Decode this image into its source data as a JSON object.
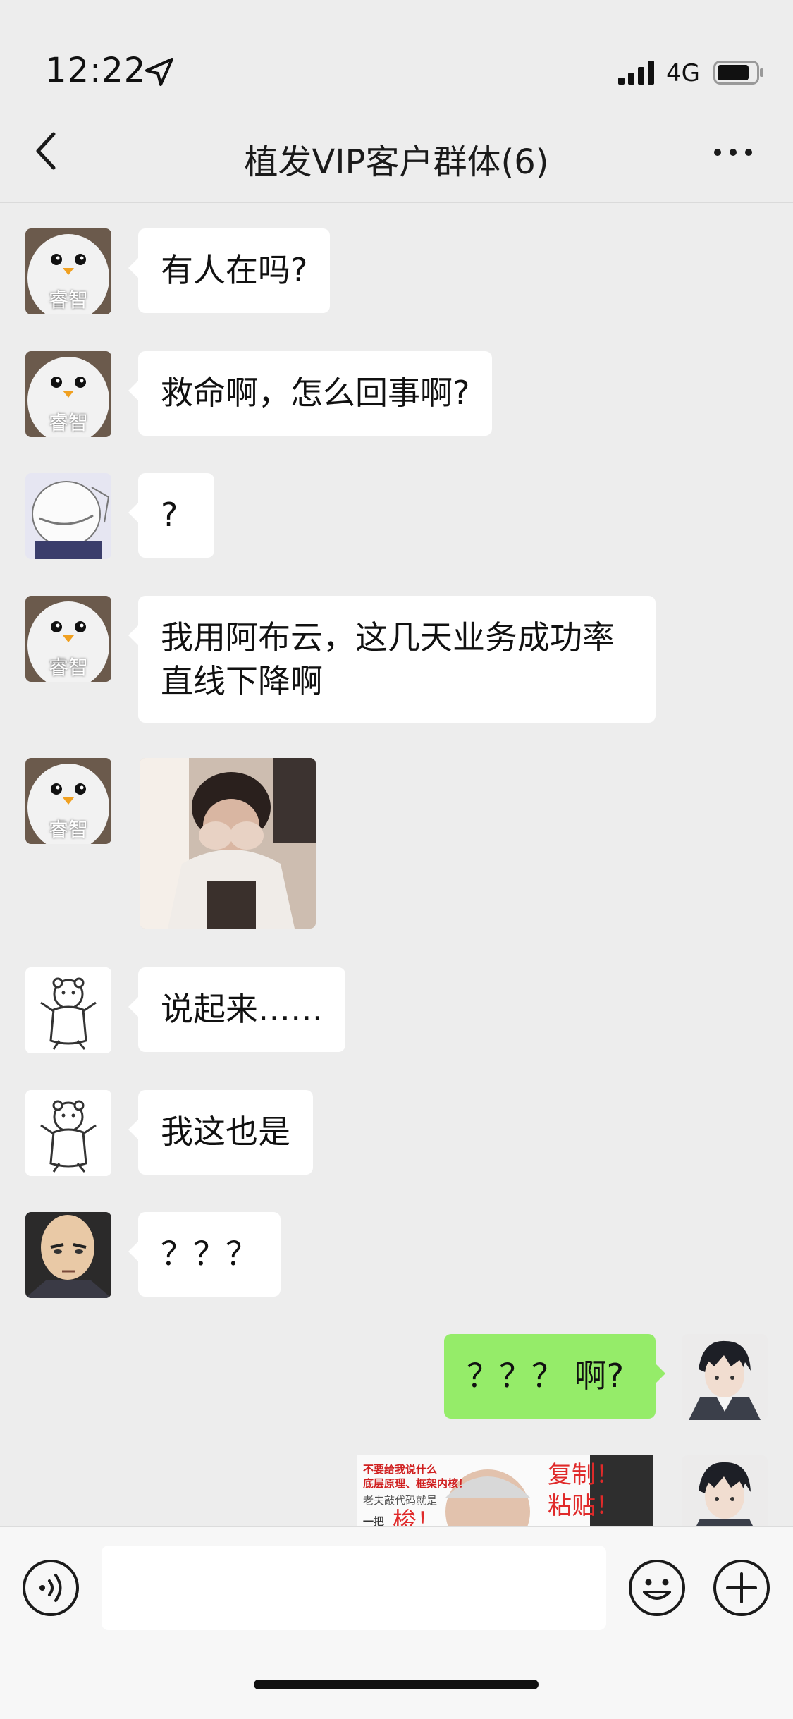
{
  "status_bar": {
    "time": "12:22",
    "network": "4G"
  },
  "nav": {
    "title": "植发VIP客户群体(6)",
    "back_icon": "chevron-left-icon",
    "more_icon": "more-horizontal-icon"
  },
  "avatars": {
    "penguin_caption": "睿智"
  },
  "messages": [
    {
      "side": "left",
      "avatar": "penguin",
      "text": "有人在吗?"
    },
    {
      "side": "left",
      "avatar": "penguin",
      "text": "救命啊，怎么回事啊?"
    },
    {
      "side": "left",
      "avatar": "belly",
      "text": "?"
    },
    {
      "side": "left",
      "avatar": "penguin",
      "text": "我用阿布云，这几天业务成功率\n直线下降啊"
    },
    {
      "side": "left",
      "avatar": "penguin",
      "type": "image",
      "image": "crying-girl-photo"
    },
    {
      "side": "left",
      "avatar": "bear",
      "text": "说起来……"
    },
    {
      "side": "left",
      "avatar": "bear",
      "text": "我这也是"
    },
    {
      "side": "left",
      "avatar": "bald-hero",
      "text": "？？？"
    },
    {
      "side": "right",
      "avatar": "anime-boy",
      "text": "？？？ 啊?"
    },
    {
      "side": "right",
      "avatar": "anime-boy",
      "type": "image",
      "image": "copy-paste-meme"
    }
  ],
  "meme": {
    "line1": "不要给我说什么",
    "line2": "底层原理、框架内核！",
    "line3": "老夫敲代码就是",
    "line4": "一把",
    "line5": "梭！",
    "big1": "复制！",
    "big2": "粘贴！"
  },
  "input_bar": {
    "placeholder": "",
    "voice_icon": "voice-icon",
    "emoji_icon": "emoji-icon",
    "plus_icon": "plus-icon"
  },
  "colors": {
    "background": "#ededed",
    "bubble_left": "#ffffff",
    "bubble_right": "#95ec69"
  }
}
